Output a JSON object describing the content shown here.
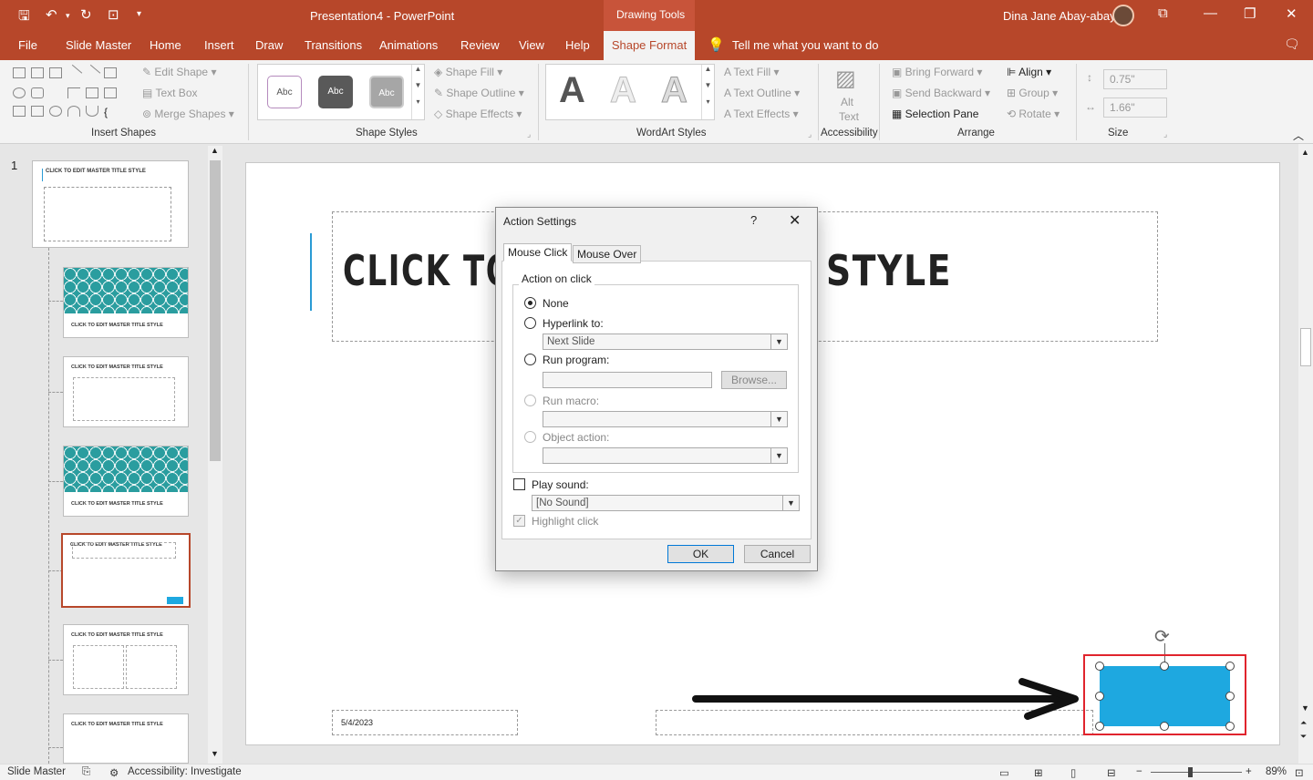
{
  "window": {
    "doc_title": "Presentation4  -  PowerPoint",
    "context_label": "Drawing Tools",
    "user_name": "Dina Jane Abay-abay",
    "accent": "#b7472a"
  },
  "tabs": [
    "File",
    "Slide Master",
    "Home",
    "Insert",
    "Draw",
    "Transitions",
    "Animations",
    "Review",
    "View",
    "Help"
  ],
  "active_tab": "Shape Format",
  "tell_me": "Tell me what you want to do",
  "ribbon": {
    "insert_shapes": {
      "edit_shape": "Edit Shape",
      "text_box": "Text Box",
      "merge_shapes": "Merge Shapes",
      "label": "Insert Shapes"
    },
    "shape_styles": {
      "abc": "Abc",
      "shape_fill": "Shape Fill",
      "shape_outline": "Shape Outline",
      "shape_effects": "Shape Effects",
      "label": "Shape Styles"
    },
    "wordart": {
      "glyph": "A",
      "text_fill": "Text Fill",
      "text_outline": "Text Outline",
      "text_effects": "Text Effects",
      "label": "WordArt Styles"
    },
    "accessibility": {
      "alt_text_1": "Alt",
      "alt_text_2": "Text",
      "label": "Accessibility"
    },
    "arrange": {
      "bring_forward": "Bring Forward",
      "send_backward": "Send Backward",
      "selection_pane": "Selection Pane",
      "align": "Align",
      "group": "Group",
      "rotate": "Rotate",
      "label": "Arrange"
    },
    "size": {
      "height": "0.75\"",
      "width": "1.66\"",
      "label": "Size"
    }
  },
  "slides_pane": {
    "slide_number": "1",
    "master_title": "CLICK TO EDIT MASTER TITLE STYLE"
  },
  "slide": {
    "title_left": "CLICK TO",
    "title_right": "STYLE",
    "date": "5/4/2023",
    "button_color": "#1ea8e0"
  },
  "dialog": {
    "title": "Action Settings",
    "help": "?",
    "tab_mouse_click": "Mouse Click",
    "tab_mouse_over": "Mouse Over",
    "group_label": "Action on click",
    "opt_none": "None",
    "opt_hyperlink": "Hyperlink to:",
    "hyperlink_value": "Next Slide",
    "opt_run_program": "Run program:",
    "browse": "Browse...",
    "opt_run_macro": "Run macro:",
    "opt_object_action": "Object action:",
    "play_sound": "Play sound:",
    "sound_value": "[No Sound]",
    "highlight_click": "Highlight click",
    "ok": "OK",
    "cancel": "Cancel"
  },
  "status": {
    "view": "Slide Master",
    "accessibility": "Accessibility: Investigate",
    "zoom": "89%"
  }
}
